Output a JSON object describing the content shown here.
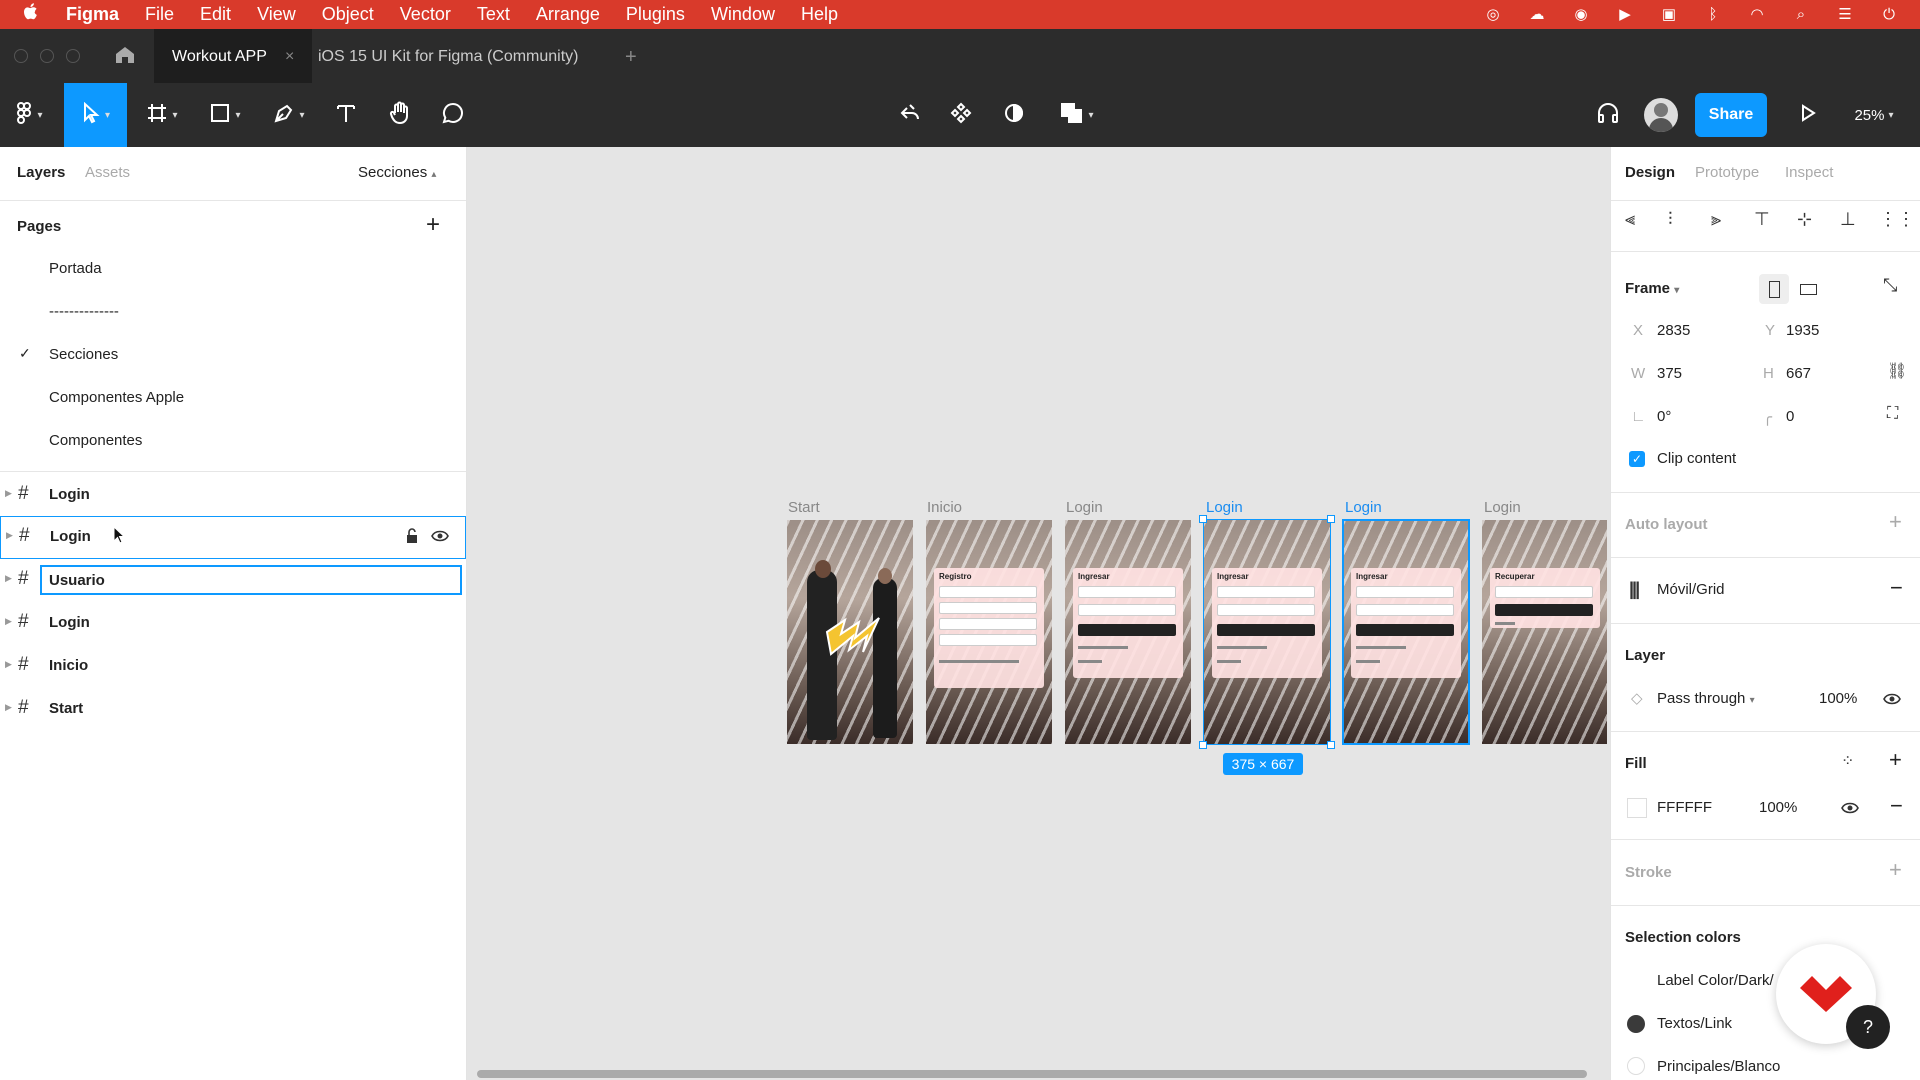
{
  "menubar": {
    "apple": "",
    "app": "Figma",
    "items": [
      "File",
      "Edit",
      "View",
      "Object",
      "Vector",
      "Text",
      "Arrange",
      "Plugins",
      "Window",
      "Help"
    ]
  },
  "tabs": {
    "active": "Workout APP",
    "close": "×",
    "other": "iOS 15 UI Kit for Figma (Community)",
    "add": "+"
  },
  "toolbar": {
    "share": "Share",
    "zoom": "25%"
  },
  "left": {
    "tab_layers": "Layers",
    "tab_assets": "Assets",
    "page_select": "Secciones",
    "pages_title": "Pages",
    "add_page": "+",
    "pages": [
      {
        "label": "Portada",
        "checked": false
      },
      {
        "label": "--------------",
        "checked": false
      },
      {
        "label": "Secciones",
        "checked": true
      },
      {
        "label": "Componentes Apple",
        "checked": false
      },
      {
        "label": "Componentes",
        "checked": false
      }
    ],
    "layers": [
      {
        "name": "Login",
        "state": "normal"
      },
      {
        "name": "Login",
        "state": "hover"
      },
      {
        "name": "Usuario",
        "state": "editing"
      },
      {
        "name": "Login",
        "state": "normal"
      },
      {
        "name": "Inicio",
        "state": "normal"
      },
      {
        "name": "Start",
        "state": "normal"
      }
    ]
  },
  "canvas": {
    "frames": [
      {
        "label": "Start",
        "kind": "start",
        "selected": false
      },
      {
        "label": "Inicio",
        "kind": "registro",
        "selected": false,
        "card_title": "Registro"
      },
      {
        "label": "Login",
        "kind": "login",
        "selected": false,
        "card_title": "Ingresar"
      },
      {
        "label": "Login",
        "kind": "login",
        "selected": true,
        "card_title": "Ingresar"
      },
      {
        "label": "Login",
        "kind": "login",
        "selected": true,
        "card_title": "Ingresar"
      },
      {
        "label": "Login",
        "kind": "recuperar",
        "selected": false,
        "card_title": "Recuperar"
      }
    ],
    "size_badge": "375 × 667"
  },
  "right": {
    "tab_design": "Design",
    "tab_prototype": "Prototype",
    "tab_inspect": "Inspect",
    "frame_title": "Frame",
    "x_label": "X",
    "x": "2835",
    "y_label": "Y",
    "y": "1935",
    "w_label": "W",
    "w": "375",
    "h_label": "H",
    "h": "667",
    "rotation": "0°",
    "radius": "0",
    "clip": "Clip content",
    "auto_layout": "Auto layout",
    "grid": "Móvil/Grid",
    "layer_title": "Layer",
    "blend": "Pass through",
    "layer_opacity": "100%",
    "fill_title": "Fill",
    "fill_hex": "FFFFFF",
    "fill_opacity": "100%",
    "stroke_title": "Stroke",
    "selection_colors": "Selection colors",
    "colors": [
      {
        "name": "Label Color/Dark/",
        "hex": "#ffffff"
      },
      {
        "name": "Textos/Link",
        "hex": "#3a3a3a"
      },
      {
        "name": "Principales/Blanco",
        "hex": "#ffffff"
      }
    ],
    "help": "?"
  },
  "accent": "#0d99ff",
  "menubar_color": "#d93a2b"
}
